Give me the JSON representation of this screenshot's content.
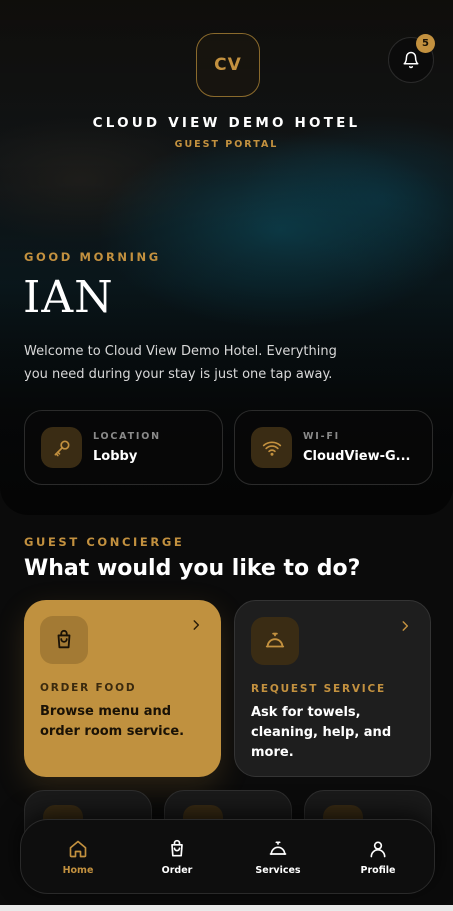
{
  "header": {
    "logo_initials": "CV",
    "hotel_name": "CLOUD VIEW DEMO HOTEL",
    "portal_label": "GUEST PORTAL",
    "notification_count": "5"
  },
  "hero": {
    "greeting": "GOOD MORNING",
    "guest_name": "IAN",
    "welcome_text": "Welcome to Cloud View Demo Hotel. Everything you need during your stay is just one tap away."
  },
  "info_cards": [
    {
      "label": "LOCATION",
      "value": "Lobby",
      "icon": "key-icon"
    },
    {
      "label": "WI-FI",
      "value": "CloudView-G...",
      "icon": "wifi-icon"
    }
  ],
  "concierge": {
    "label": "GUEST CONCIERGE",
    "title": "What would you like to do?",
    "actions": [
      {
        "label": "ORDER FOOD",
        "description": "Browse menu and order room service.",
        "icon": "shopping-bag-icon"
      },
      {
        "label": "REQUEST SERVICE",
        "description": "Ask for towels, cleaning, help, and more.",
        "icon": "service-bell-icon"
      }
    ]
  },
  "nav": {
    "items": [
      {
        "label": "Home",
        "icon": "home-icon",
        "active": true
      },
      {
        "label": "Order",
        "icon": "shopping-bag-icon"
      },
      {
        "label": "Services",
        "icon": "service-bell-icon"
      },
      {
        "label": "Profile",
        "icon": "user-icon"
      }
    ]
  },
  "colors": {
    "accent": "#c3913f",
    "background": "#0b0b0b",
    "card_dark": "#1e1e1e"
  }
}
